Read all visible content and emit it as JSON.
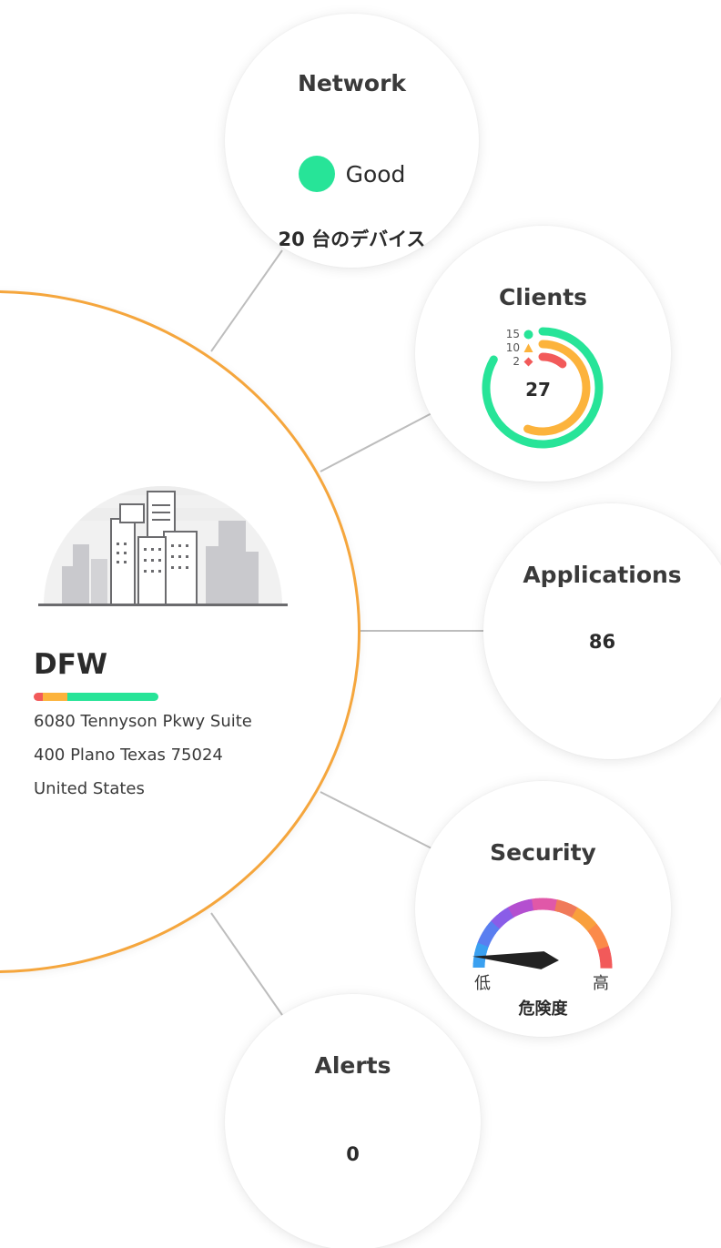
{
  "site": {
    "name": "DFW",
    "address_lines": [
      "6080 Tennyson Pkwy Suite",
      "400 Plano Texas 75024",
      "United States"
    ],
    "health_segments": [
      {
        "status": "poor",
        "fraction": 0.07,
        "color": "#f25a5a"
      },
      {
        "status": "fair",
        "fraction": 0.2,
        "color": "#fcb33c"
      },
      {
        "status": "good",
        "fraction": 0.73,
        "color": "#27e498"
      }
    ],
    "border_color": "#f5a63d"
  },
  "network": {
    "title": "Network",
    "status": "Good",
    "status_color": "#27e498",
    "devices": "20 台のデバイス"
  },
  "clients": {
    "title": "Clients",
    "total": "27",
    "legend": [
      {
        "count": "15",
        "shape": "circle-icon",
        "color": "#27e498",
        "fraction": 0.5556
      },
      {
        "count": "10",
        "shape": "triangle-icon",
        "color": "#fcb33c",
        "fraction": 0.3704
      },
      {
        "count": "2",
        "shape": "diamond-icon",
        "color": "#f25a5a",
        "fraction": 0.0741
      }
    ]
  },
  "applications": {
    "title": "Applications",
    "count": "86"
  },
  "security": {
    "title": "Security",
    "low_label": "低",
    "high_label": "高",
    "risk_label": "危険度",
    "risk_level": 0.05
  },
  "alerts": {
    "title": "Alerts",
    "count": "0"
  }
}
